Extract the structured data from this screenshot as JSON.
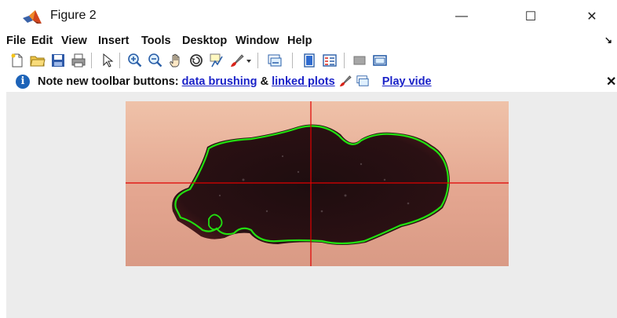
{
  "window": {
    "title": "Figure 2",
    "controls": {
      "minimize": "—",
      "maximize": "☐",
      "close": "✕"
    }
  },
  "menubar": {
    "items": [
      "File",
      "Edit",
      "View",
      "Insert",
      "Tools",
      "Desktop",
      "Window",
      "Help"
    ],
    "overflow": "↘"
  },
  "toolbar": {
    "buttons": [
      "new-figure",
      "open-file",
      "save",
      "print",
      "edit-plot-pointer",
      "zoom-in",
      "zoom-out",
      "pan",
      "rotate-3d",
      "data-cursor",
      "brush",
      "brush-dropdown",
      "link-plot",
      "insert-colorbar",
      "insert-legend",
      "hide-plot-tools",
      "show-plot-tools"
    ]
  },
  "notebar": {
    "prefix": "Note new toolbar buttons:",
    "link1": "data brushing",
    "amp": "&",
    "link2": "linked plots",
    "play_link": "Play vide",
    "close": "✕"
  },
  "figure": {
    "image": "skin lesion photo with green segmentation contour",
    "contour_color": "#22e010",
    "crosshair_color": "#e00000",
    "background_color": "#ececec"
  }
}
